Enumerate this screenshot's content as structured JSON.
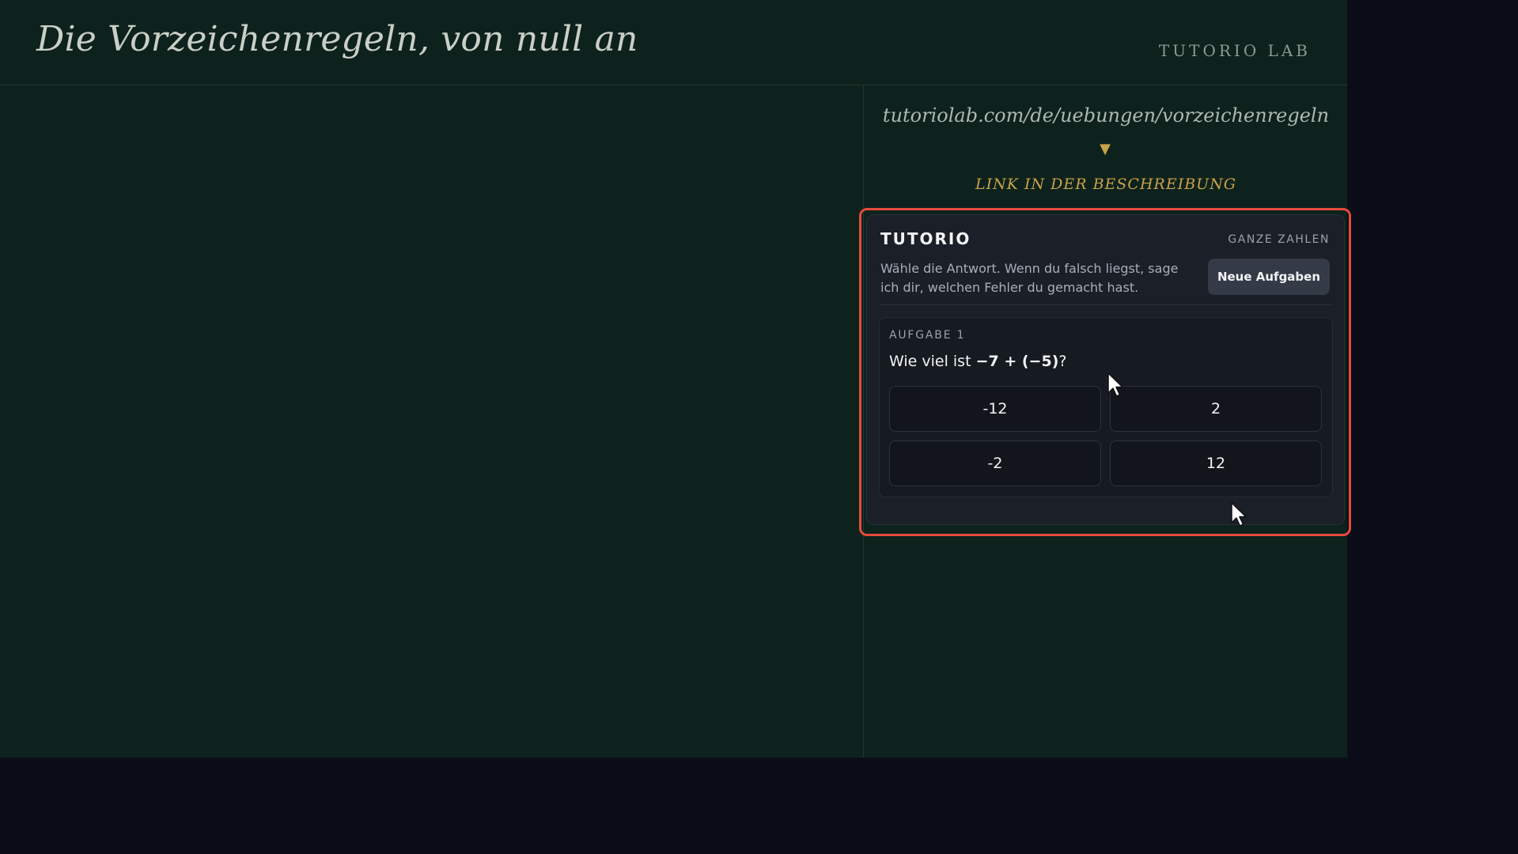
{
  "header": {
    "title": "Die Vorzeichenregeln, von null an",
    "brand": "TUTORIO LAB"
  },
  "promo": {
    "url": "tutoriolab.com/de/uebungen/vorzeichenregeln",
    "arrow": "▼",
    "link_text": "LINK IN DER BESCHREIBUNG"
  },
  "widget": {
    "title": "TUTORIO",
    "topic": "GANZE ZAHLEN",
    "description": "Wähle die Antwort. Wenn du falsch liegst, sage ich dir, welchen Fehler du gemacht hast.",
    "new_button": "Neue Aufgaben",
    "task": {
      "label": "AUFGABE 1",
      "question_prefix": "Wie viel ist ",
      "question_expression": "−7 + (−5)",
      "question_suffix": "?",
      "answers": [
        "-12",
        "2",
        "-2",
        "12"
      ]
    }
  },
  "colors": {
    "stage_bg": "#0e221d",
    "outer_bg": "#0a0d18",
    "accent_gold": "#c9a24a",
    "highlight_red": "#e64a3b",
    "card_bg": "#1b1f27"
  }
}
